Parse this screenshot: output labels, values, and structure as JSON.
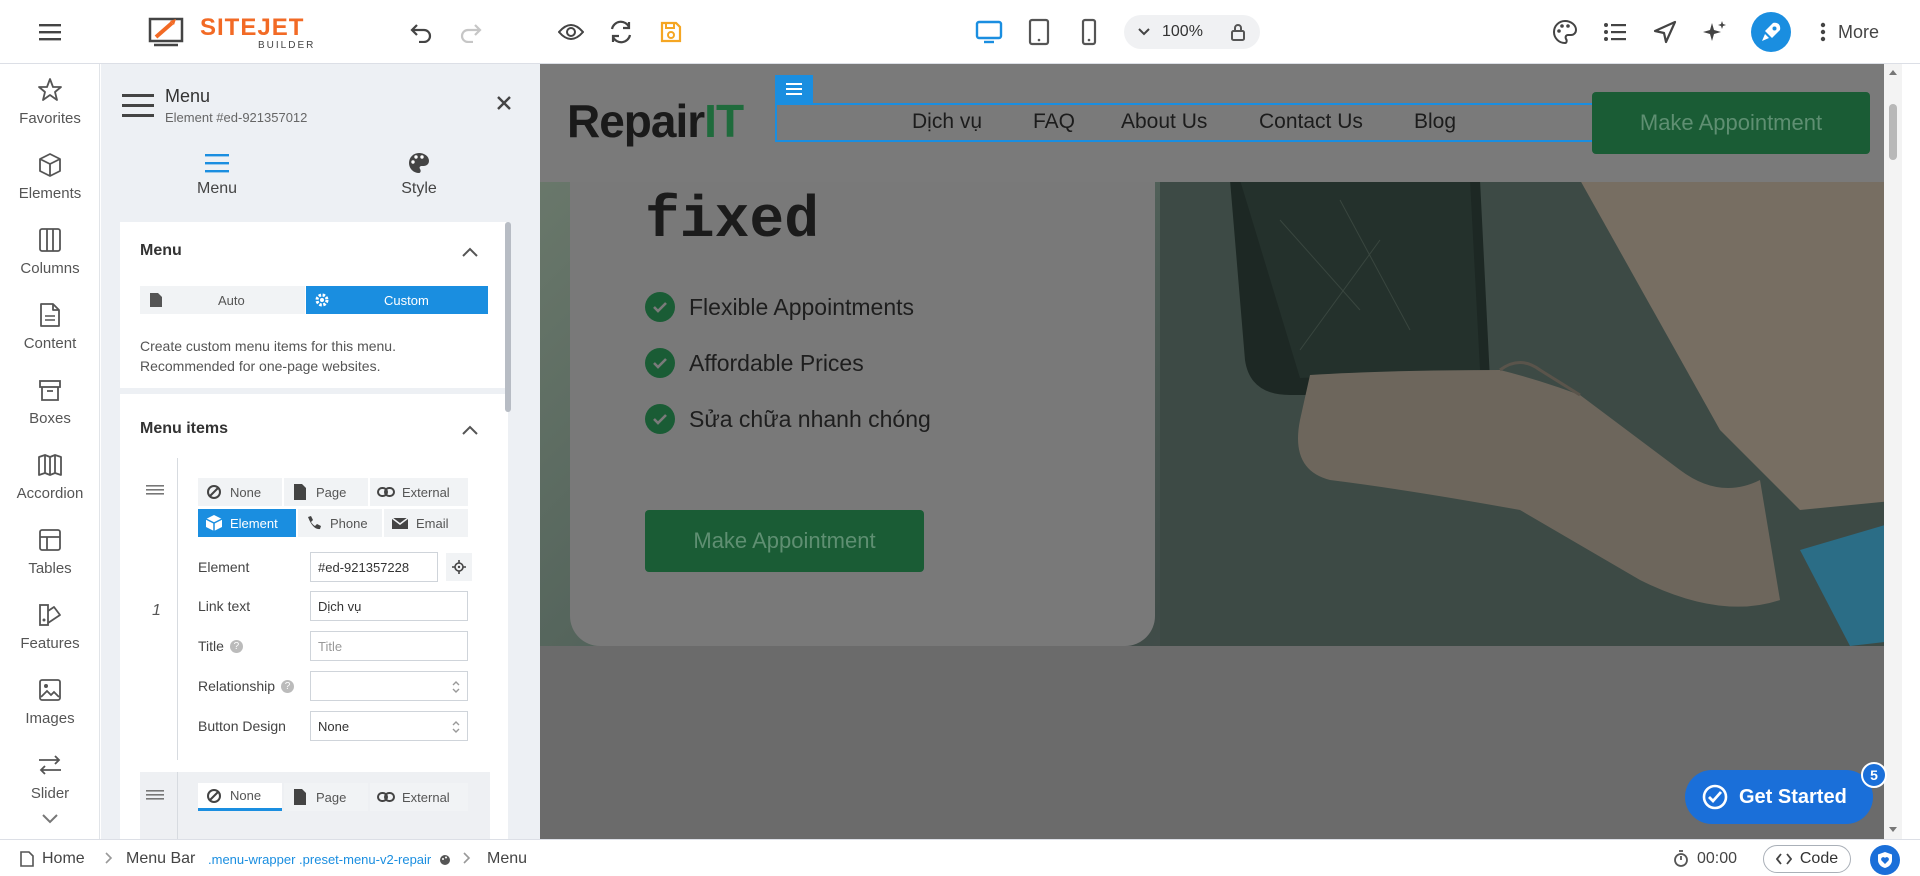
{
  "topbar": {
    "logo": {
      "main": "SITEJET",
      "sub": "BUILDER"
    },
    "zoom": "100%",
    "more_label": "More"
  },
  "rail": {
    "items": [
      {
        "label": "Favorites",
        "icon": "star-icon"
      },
      {
        "label": "Elements",
        "icon": "cube-icon"
      },
      {
        "label": "Columns",
        "icon": "columns-icon"
      },
      {
        "label": "Content",
        "icon": "file-icon"
      },
      {
        "label": "Boxes",
        "icon": "box-icon"
      },
      {
        "label": "Accordion",
        "icon": "accordion-icon"
      },
      {
        "label": "Tables",
        "icon": "table-icon"
      },
      {
        "label": "Features",
        "icon": "features-icon"
      },
      {
        "label": "Images",
        "icon": "image-icon"
      },
      {
        "label": "Slider",
        "icon": "slider-icon"
      }
    ]
  },
  "panel": {
    "title": "Menu",
    "subtitle": "Element #ed-921357012",
    "tabs": [
      {
        "label": "Menu"
      },
      {
        "label": "Style"
      }
    ],
    "menu_section": {
      "title": "Menu",
      "options": [
        "Auto",
        "Custom"
      ],
      "selected": "Custom",
      "description": "Create custom menu items for this menu. Recommended for one-page websites."
    },
    "menu_items_section": {
      "title": "Menu items",
      "item1": {
        "number": "1",
        "types": [
          "None",
          "Page",
          "External",
          "Element",
          "Phone",
          "Email"
        ],
        "selected_type": "Element",
        "fields": {
          "element_label": "Element",
          "element_value": "#ed-921357228",
          "link_text_label": "Link text",
          "link_text_value": "Dịch vụ",
          "title_label": "Title",
          "title_placeholder": "Title",
          "relationship_label": "Relationship",
          "relationship_value": "",
          "button_design_label": "Button Design",
          "button_design_value": "None"
        }
      },
      "item2": {
        "types": [
          "None",
          "Page",
          "External"
        ],
        "selected_type": "None"
      }
    }
  },
  "site": {
    "brand": {
      "part1": "Repair",
      "part2": "IT"
    },
    "nav": [
      "Dịch vụ",
      "FAQ",
      "About Us",
      "Contact Us",
      "Blog"
    ],
    "header_button": "Make Appointment",
    "hero": {
      "big_text": "fixed",
      "features": [
        "Flexible Appointments",
        "Affordable Prices",
        "Sửa chữa nhanh chóng"
      ],
      "button": "Make Appointment"
    }
  },
  "get_started": {
    "label": "Get Started",
    "badge": "5"
  },
  "breadcrumb": {
    "items": [
      "Home",
      "Menu Bar",
      ".menu-wrapper .preset-menu-v2-repair",
      "Menu"
    ]
  },
  "bottombar": {
    "timer": "00:00",
    "code_label": "Code"
  },
  "colors": {
    "accent": "#1a8ee0",
    "brand_orange": "#f26a25",
    "site_green": "#1a5c35"
  }
}
